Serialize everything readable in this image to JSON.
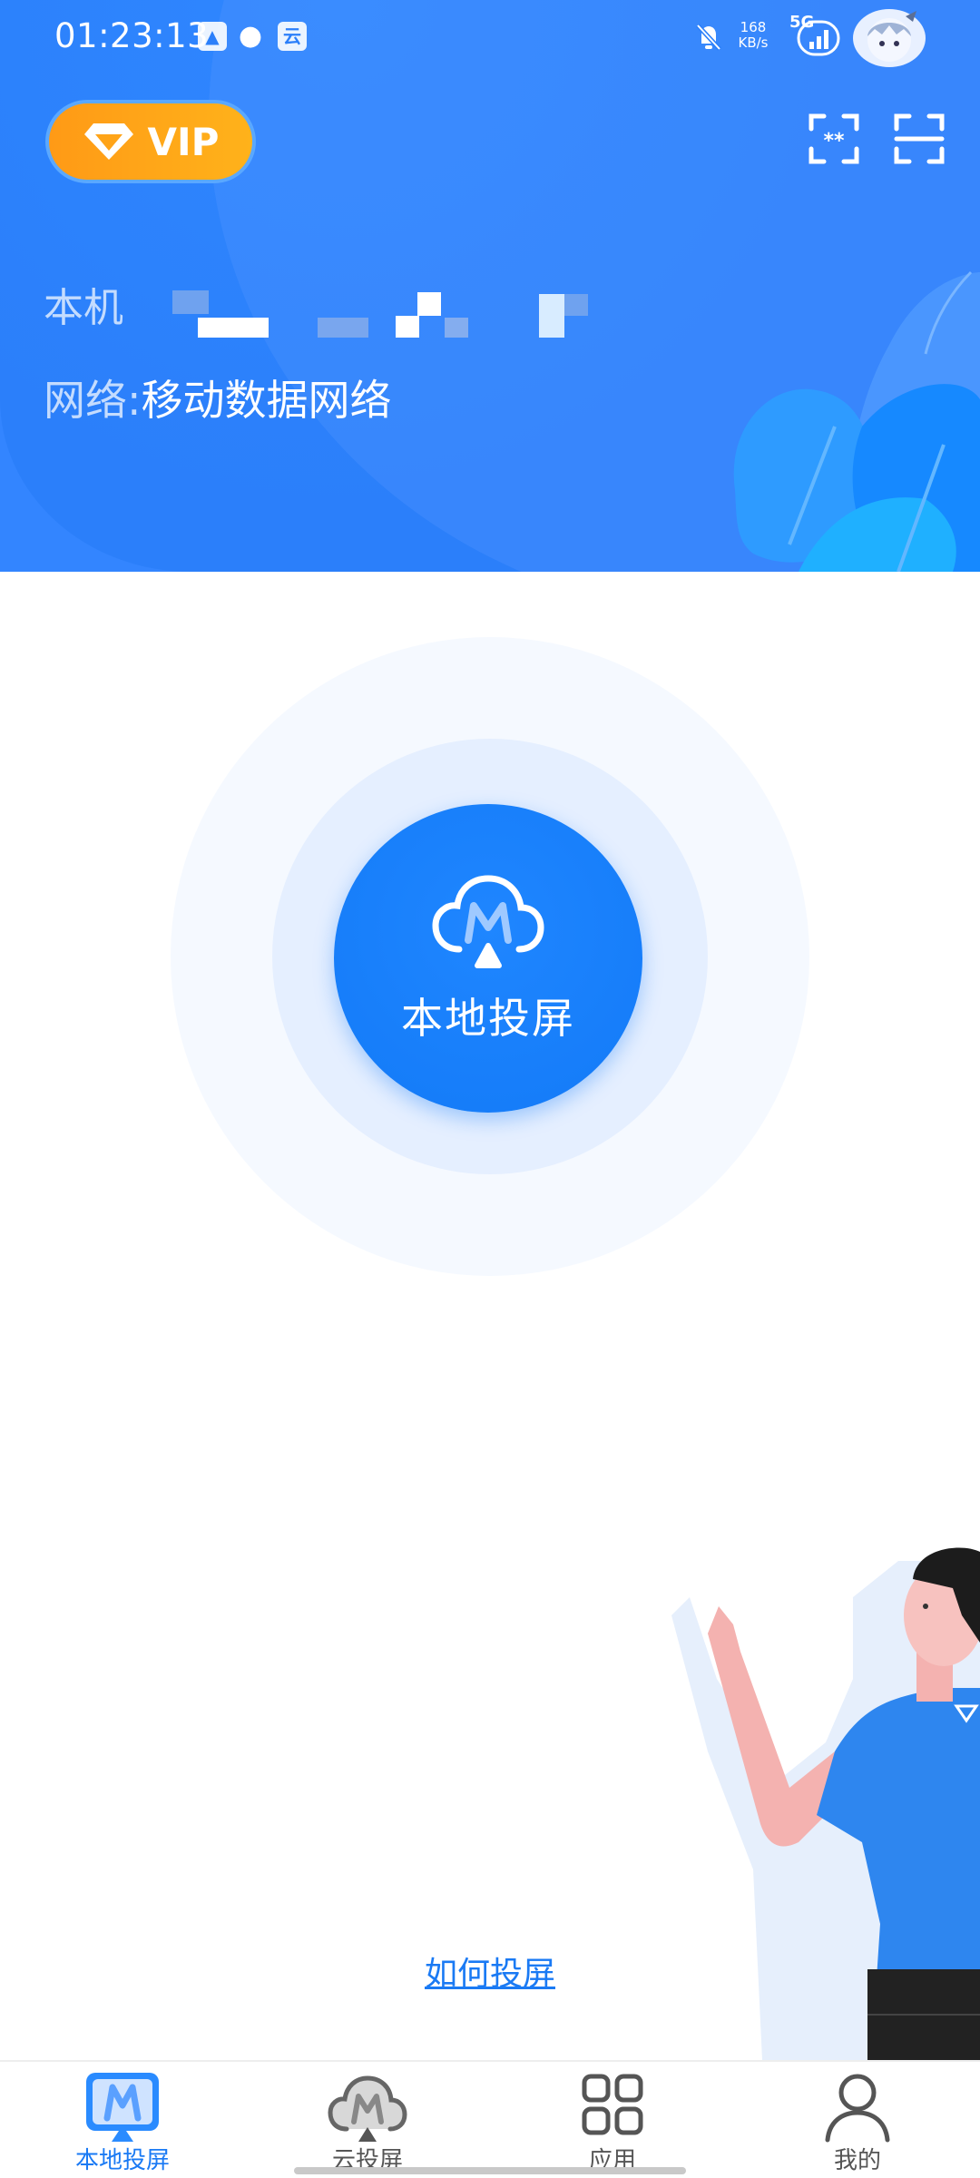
{
  "status_bar": {
    "time": "01:23:13",
    "net_speed_value": "168",
    "net_speed_unit": "KB/s",
    "signal_label": "5G"
  },
  "header": {
    "vip_label": "VIP",
    "device_label": "本机",
    "network_key": "网络:",
    "network_value": "移动数据网络"
  },
  "main": {
    "cast_button_label": "本地投屏",
    "howto_link": "如何投屏"
  },
  "bottom_nav": {
    "items": [
      {
        "label": "本地投屏",
        "active": true
      },
      {
        "label": "云投屏",
        "active": false
      },
      {
        "label": "应用",
        "active": false
      },
      {
        "label": "我的",
        "active": false
      }
    ]
  },
  "colors": {
    "brand_blue": "#137af7",
    "header_blue": "#2b7ffa",
    "vip_orange": "#ffa418",
    "link_blue": "#1a7af4"
  }
}
